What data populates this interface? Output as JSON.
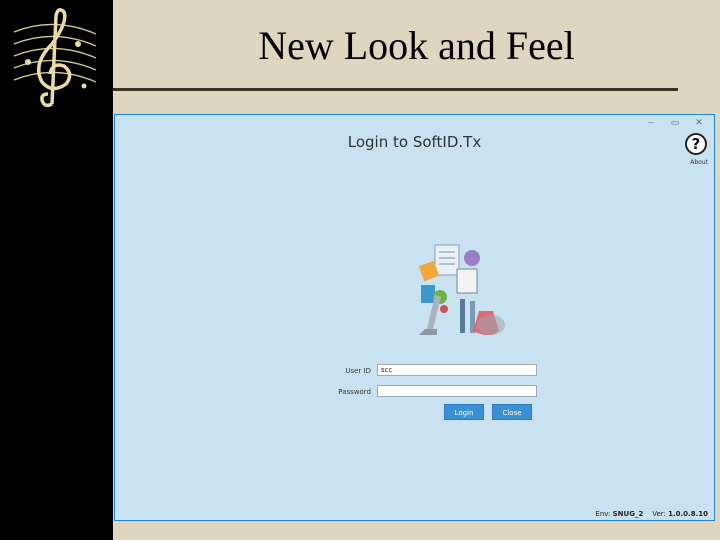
{
  "slide": {
    "title": "New Look and Feel"
  },
  "window": {
    "controls": {
      "minimize": "‒",
      "maximize": "▭",
      "close": "✕"
    },
    "heading": "Login to SoftID.Tx",
    "help_icon_glyph": "?",
    "about_label": "About",
    "user_id_label": "User ID",
    "user_id_value": "scc",
    "password_label": "Password",
    "password_value": "",
    "login_label": "Login",
    "close_label": "Close",
    "footer": {
      "env_label": "Env:",
      "env_value": "SNUG_2",
      "ver_label": "Ver:",
      "ver_value": "1.0.0.8.10"
    }
  },
  "colors": {
    "window_bg": "#c9e2f1",
    "window_border": "#1f86d9",
    "button": "#3b8fd4",
    "slide_bg": "#ded6bf"
  }
}
